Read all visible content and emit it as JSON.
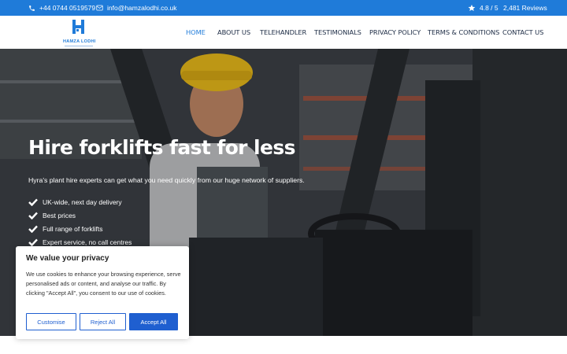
{
  "topbar": {
    "phone": "+44 0744 0519579",
    "email": "info@hamzalodhi.co.uk",
    "rating": "4.8 / 5",
    "reviews": "2,481 Reviews"
  },
  "header": {
    "logo_text": "HAMZA LODHI",
    "nav": [
      "HOME",
      "ABOUT US",
      "TELEHANDLER",
      "TESTIMONIALS",
      "PRIVACY POLICY",
      "TERMS & CONDITIONS",
      "CONTACT US"
    ],
    "active_index": 0
  },
  "hero": {
    "title": "Hire forklifts fast for less",
    "subtitle": "Hyra's plant hire experts can get what you need quickly from our huge network of suppliers.",
    "bullets": [
      "UK-wide, next day delivery",
      "Best prices",
      "Full range of forklifts",
      "Expert service, no call centres"
    ]
  },
  "cookie": {
    "title": "We value your privacy",
    "text": "We use cookies to enhance your browsing experience, serve personalised ads or content, and analyse our traffic. By clicking \"Accept All\", you consent to our use of cookies.",
    "customise": "Customise",
    "reject": "Reject All",
    "accept": "Accept All"
  },
  "colors": {
    "brand": "#1f7bd9",
    "button": "#1f5fd0",
    "helmet": "#f2c21b"
  },
  "icons": [
    "phone-icon",
    "mail-icon",
    "star-icon",
    "check-icon",
    "logo-mark-icon"
  ]
}
